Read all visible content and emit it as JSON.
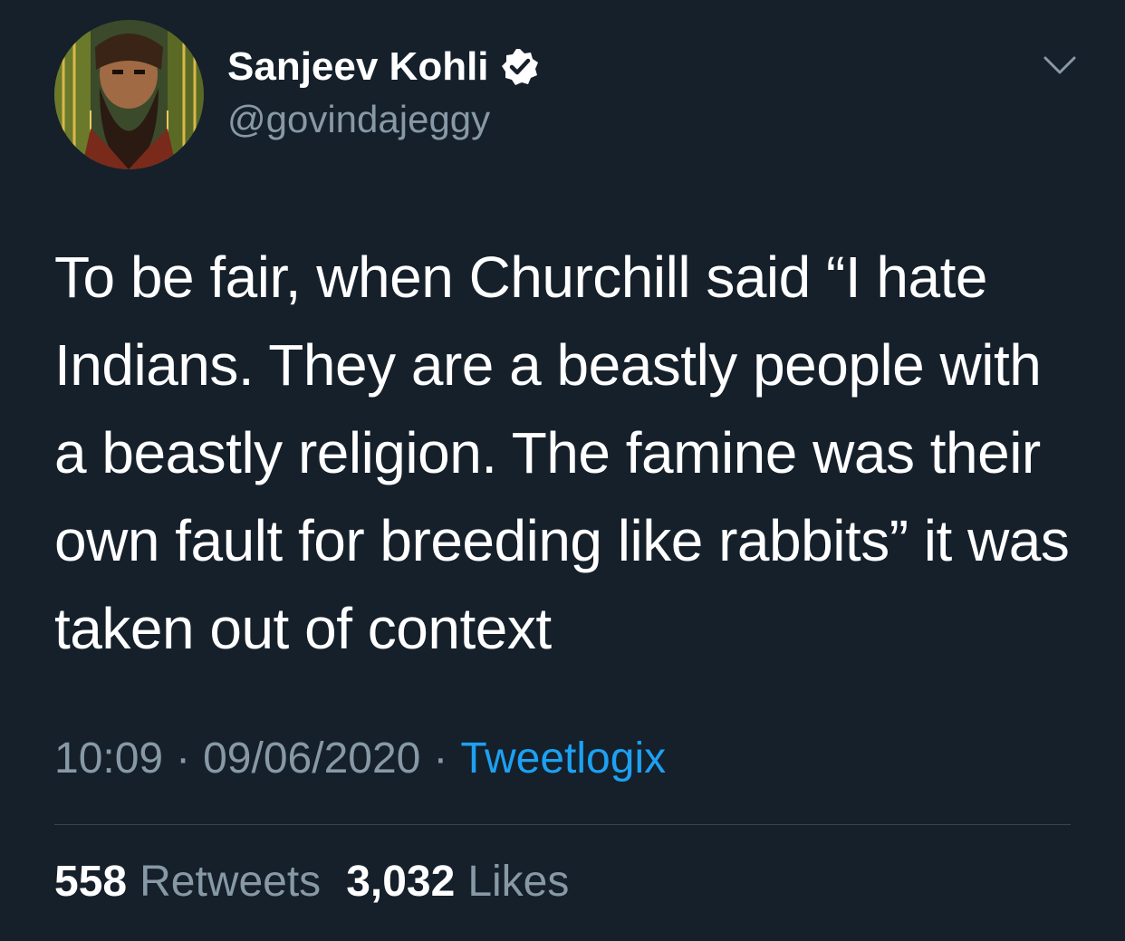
{
  "author": {
    "display_name": "Sanjeev Kohli",
    "handle": "@govindajeggy",
    "verified": true,
    "avatar_icon": "profile-photo"
  },
  "tweet": {
    "text": "To be fair, when Churchill said “I hate Indians. They are a beastly people with a beastly religion. The famine was their own fault for breeding like rabbits” it was taken out of context",
    "time": "10:09",
    "date": "09/06/2020",
    "separator": "·",
    "client": "Tweetlogix"
  },
  "stats": {
    "retweets_count": "558",
    "retweets_label": "Retweets",
    "likes_count": "3,032",
    "likes_label": "Likes"
  },
  "colors": {
    "background": "#15202b",
    "secondary_text": "#8899a6",
    "accent": "#1da1f2",
    "divider": "#38444d"
  },
  "icons": {
    "verified": "verified-badge-icon",
    "menu": "chevron-down-icon"
  }
}
